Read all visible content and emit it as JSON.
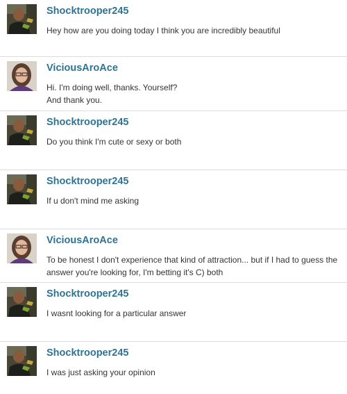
{
  "users": {
    "shock": "Shocktrooper245",
    "vicious": "ViciousAroAce"
  },
  "messages": [
    {
      "user": "Shocktrooper245",
      "avatar": "male-user-avatar",
      "text": "Hey how are you doing today I think you are incredibly beautiful"
    },
    {
      "user": "ViciousAroAce",
      "avatar": "female-user-avatar",
      "text_lines": [
        "Hi. I'm doing well, thanks. Yourself?",
        "And thank you."
      ]
    },
    {
      "user": "Shocktrooper245",
      "avatar": "male-user-avatar",
      "text": "Do you think I'm cute or sexy or both"
    },
    {
      "user": "Shocktrooper245",
      "avatar": "male-user-avatar",
      "text": "If u don't mind me asking"
    },
    {
      "user": "ViciousAroAce",
      "avatar": "female-user-avatar",
      "text_lines": [
        "To be honest I don't experience that kind of attraction... but if I had to guess the",
        "answer you're looking for, I'm betting it's C) both"
      ]
    },
    {
      "user": "Shocktrooper245",
      "avatar": "male-user-avatar",
      "text": "I wasnt looking for a particular answer"
    },
    {
      "user": "Shocktrooper245",
      "avatar": "male-user-avatar",
      "text": "I was just asking your opinion"
    }
  ],
  "colors": {
    "username": "#2d7393",
    "text": "#333333",
    "divider": "#dcdcdc"
  }
}
